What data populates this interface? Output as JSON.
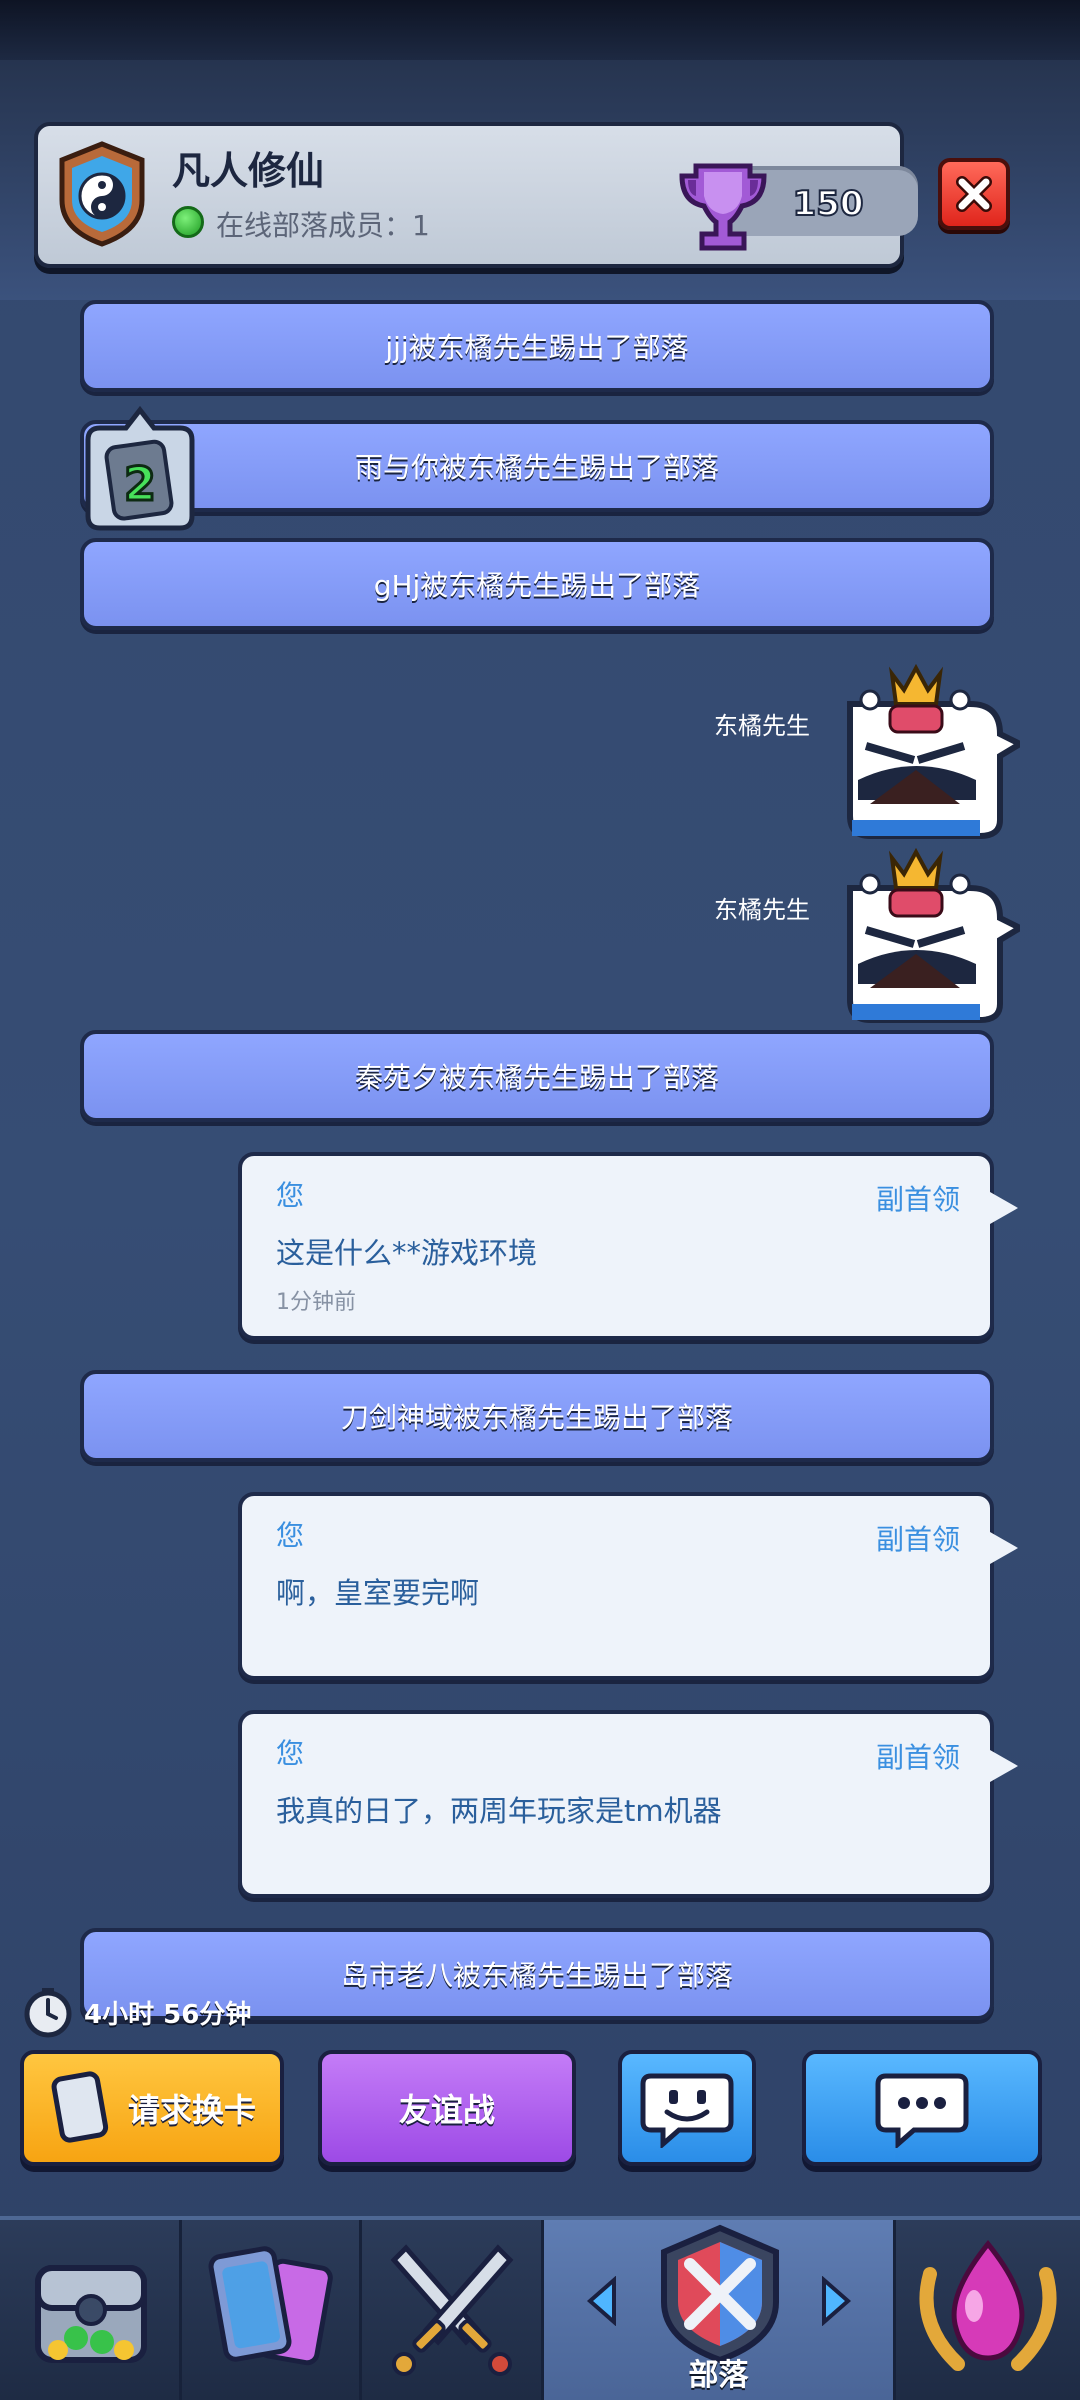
{
  "header": {
    "clan_name": "凡人修仙",
    "online_members": "在线部落成员：1",
    "trophies": "150"
  },
  "card_request_count": "2",
  "system_messages": [
    "jjj被东橘先生踢出了部落",
    "雨与你被东橘先生踢出了部落",
    "gHj被东橘先生踢出了部落",
    "秦苑夕被东橘先生踢出了部落",
    "刀剑神域被东橘先生踢出了部落",
    "岛市老八被东橘先生踢出了部落"
  ],
  "emote_messages": [
    {
      "sender": "东橘先生",
      "emote": "angry-king-emote"
    },
    {
      "sender": "东橘先生",
      "emote": "angry-king-emote"
    }
  ],
  "chat_messages": [
    {
      "author": "您",
      "role": "副首领",
      "text": "这是什么**游戏环境",
      "time": "1分钟前"
    },
    {
      "author": "您",
      "role": "副首领",
      "text": "啊，皇室要完啊",
      "time": ""
    },
    {
      "author": "您",
      "role": "副首领",
      "text": "我真的日了，两周年玩家是tm机器",
      "time": ""
    }
  ],
  "timer": "4小时 56分钟",
  "actions": {
    "request_cards": "请求换卡",
    "friendly_battle": "友谊战"
  },
  "nav": {
    "active_label": "部落"
  },
  "colors": {
    "system_message_bg": "#8fa6ff",
    "chat_text": "#2a5f9c",
    "role_text": "#3a8fe0",
    "request_button": "#f7a412",
    "friendly_button": "#9d4ae6",
    "chat_button": "#2a8de8"
  }
}
